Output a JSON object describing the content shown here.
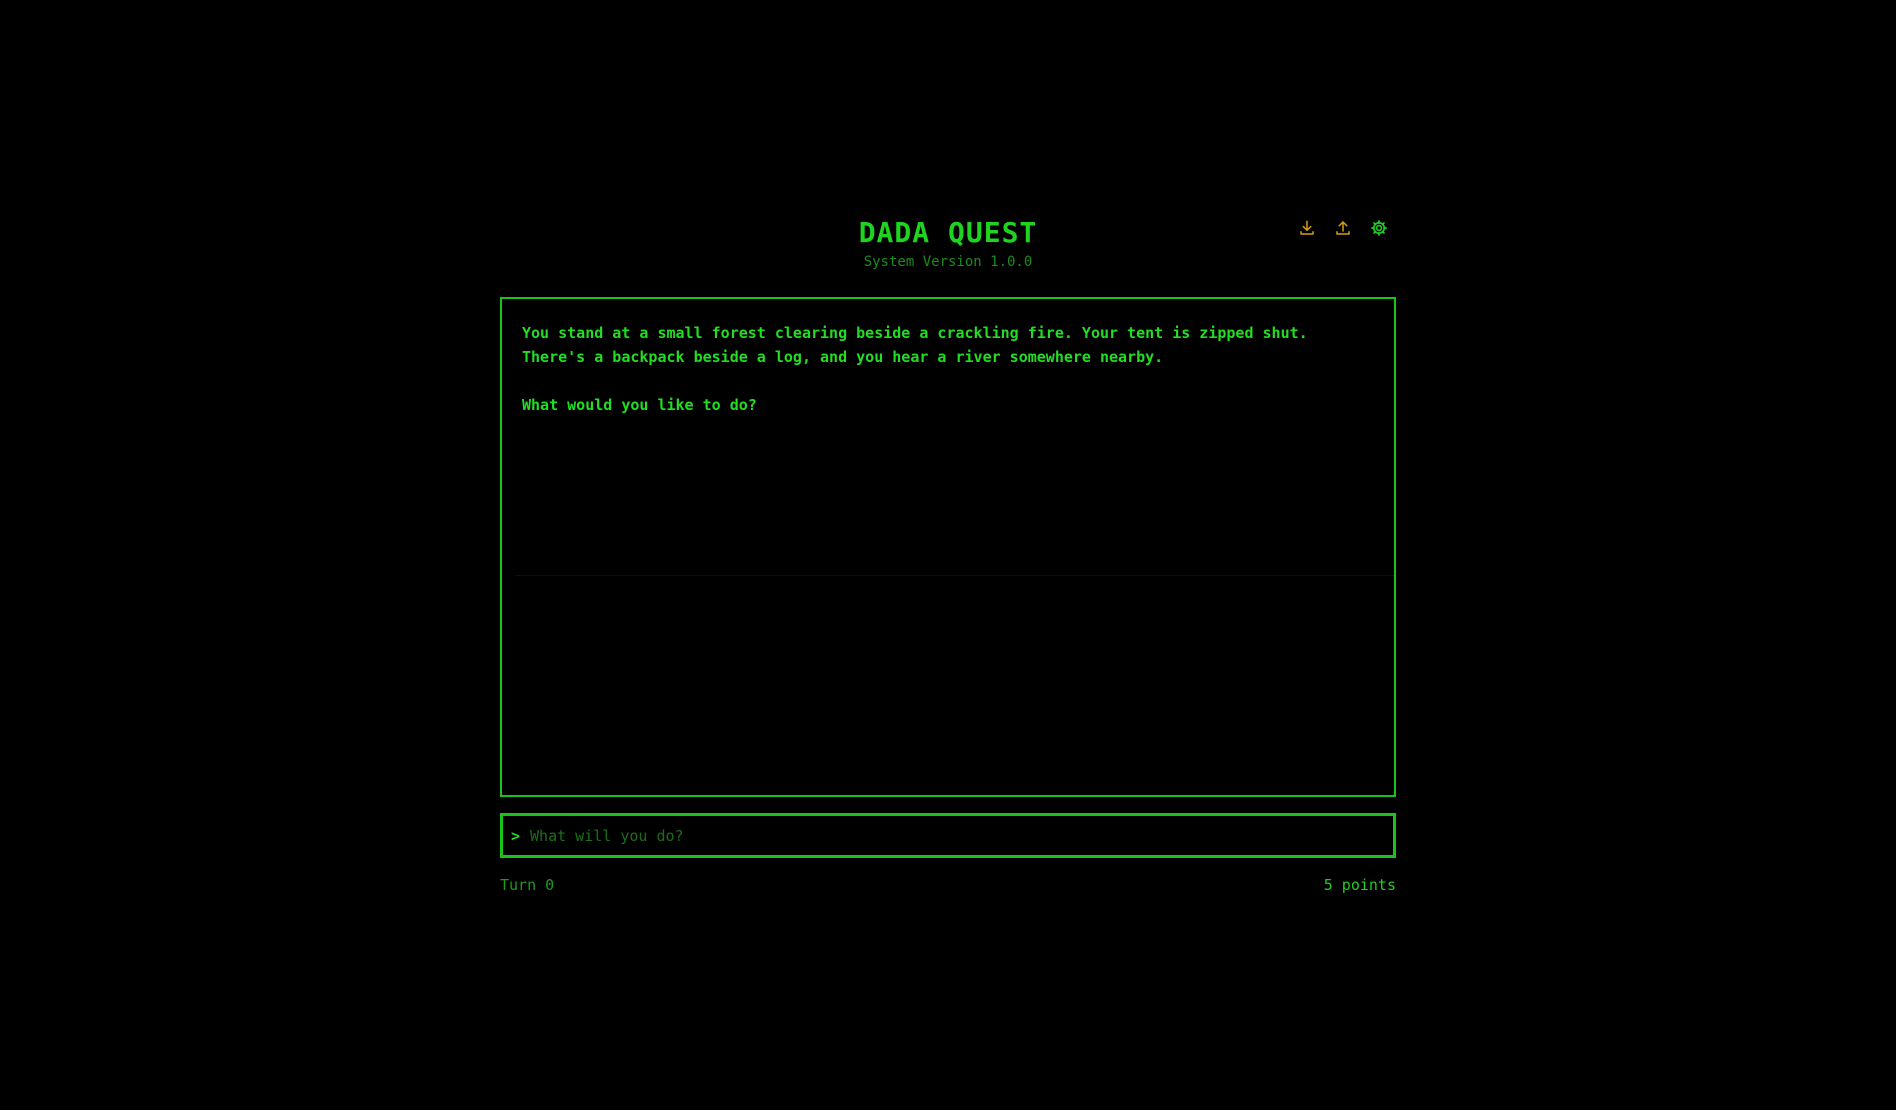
{
  "header": {
    "title": "DADA QUEST",
    "version": "System Version 1.0.0"
  },
  "toolbar": {
    "icons": [
      "download-icon",
      "upload-icon",
      "gear-icon"
    ],
    "icon_color": "#d4a017",
    "gear_color": "#22cc22"
  },
  "story": {
    "paragraphs": [
      "You stand at a small forest clearing beside a crackling fire. Your tent is zipped shut. There's a backpack beside a log, and you hear a river somewhere nearby.",
      "What would you like to do?"
    ]
  },
  "command": {
    "prompt": ">",
    "placeholder": "What will you do?",
    "value": ""
  },
  "status": {
    "turn": "Turn 0",
    "points": "5 points"
  },
  "colors": {
    "background": "#000000",
    "terminal_green": "#22dd22",
    "border_green": "#19c419",
    "dim_green": "#1d8a1d"
  }
}
